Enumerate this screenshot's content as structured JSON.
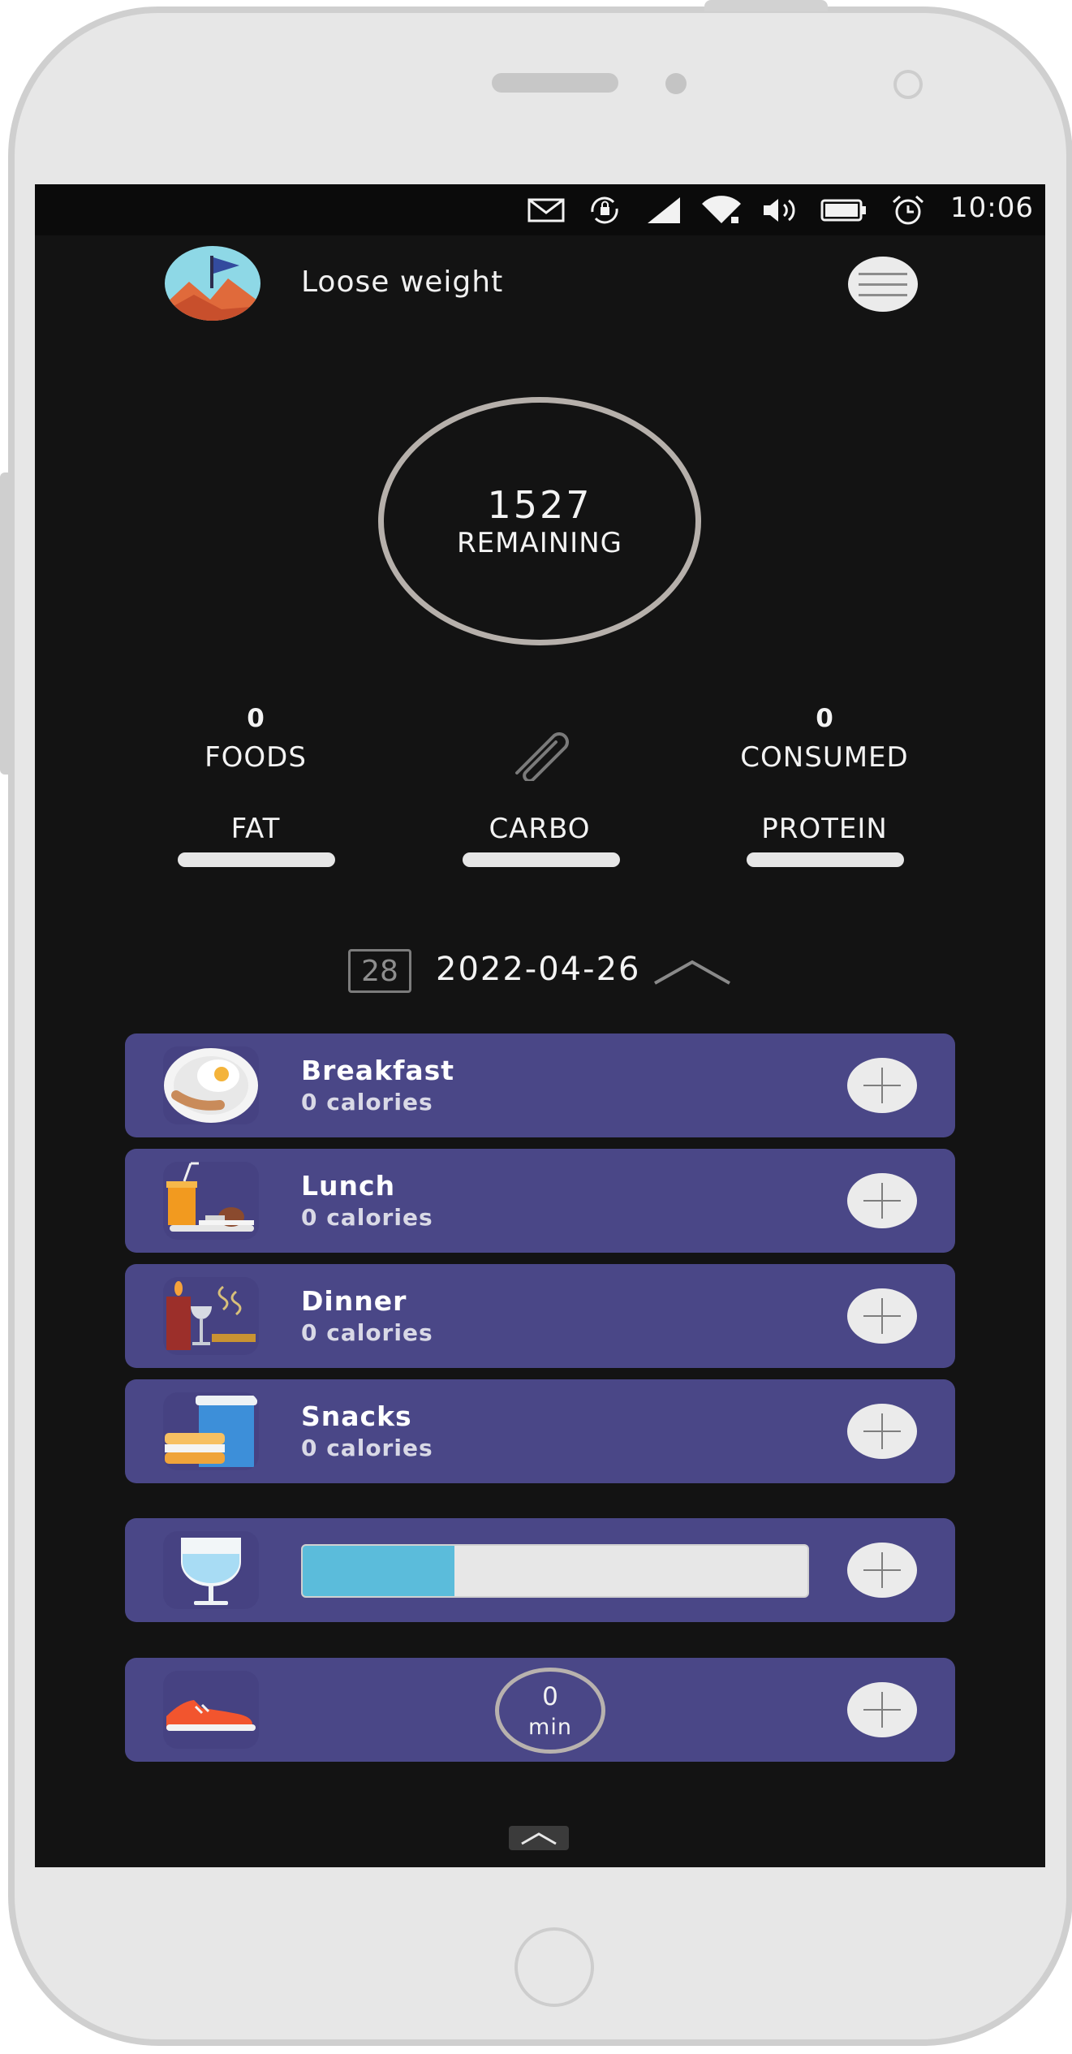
{
  "status_bar": {
    "time": "10:06",
    "icons": [
      "mail-icon",
      "rotation-lock-icon",
      "signal-icon",
      "wifi-icon",
      "volume-icon",
      "battery-icon",
      "alarm-icon"
    ]
  },
  "header": {
    "goal_title": "Loose weight",
    "menu_icon": "hamburger-menu-icon"
  },
  "summary": {
    "remaining_value": "1527",
    "remaining_label": "REMAINING",
    "foods_value": "0",
    "foods_label": "FOODS",
    "consumed_value": "0",
    "consumed_label": "CONSUMED",
    "center_icon": "paperclip-icon"
  },
  "macros": {
    "fat_label": "FAT",
    "carbo_label": "CARBO",
    "protein_label": "PROTEIN"
  },
  "date_row": {
    "calendar_day": "28",
    "date": "2022-04-26",
    "toggle_icon": "chevron-up-icon"
  },
  "meals": [
    {
      "name": "Breakfast",
      "calories": "0 calories",
      "icon": "breakfast-icon"
    },
    {
      "name": "Lunch",
      "calories": "0 calories",
      "icon": "lunch-icon"
    },
    {
      "name": "Dinner",
      "calories": "0 calories",
      "icon": "dinner-icon"
    },
    {
      "name": "Snacks",
      "calories": "0 calories",
      "icon": "snacks-icon"
    }
  ],
  "water": {
    "icon": "water-glass-icon",
    "progress_fraction": 0.3
  },
  "exercise": {
    "icon": "running-shoe-icon",
    "value": "0",
    "unit": "min"
  },
  "colors": {
    "screen_background": "#131313",
    "card": "#4a4787",
    "water_fill": "#5bbcdb",
    "ring": "#b6b0ab"
  }
}
